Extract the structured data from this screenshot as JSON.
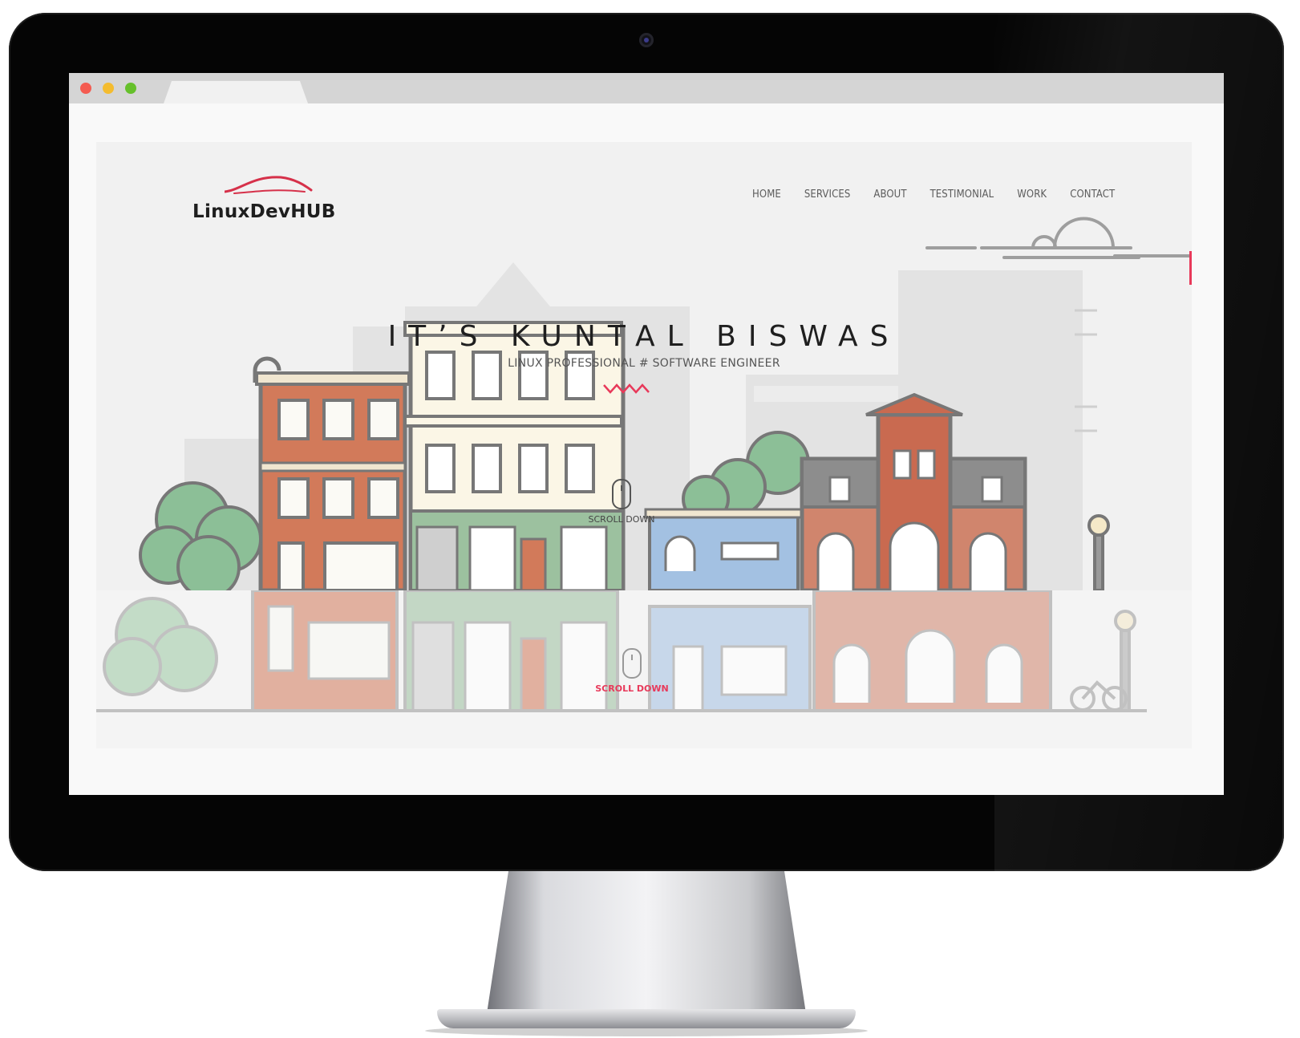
{
  "site": {
    "logo_text": "LinuxDevHUB",
    "nav": [
      "HOME",
      "SERVICES",
      "ABOUT",
      "TESTIMONIAL",
      "WORK",
      "CONTACT"
    ],
    "hero_title": "IT’S KUNTAL BISWAS",
    "hero_subtitle": "LINUX PROFESSIONAL # SOFTWARE ENGINEER",
    "scroll_label": "SCROLL DOWN",
    "scroll_label_secondary": "SCROLL DOWN"
  },
  "colors": {
    "accent": "#e8395a",
    "logo_swoosh": "#d6314a"
  }
}
